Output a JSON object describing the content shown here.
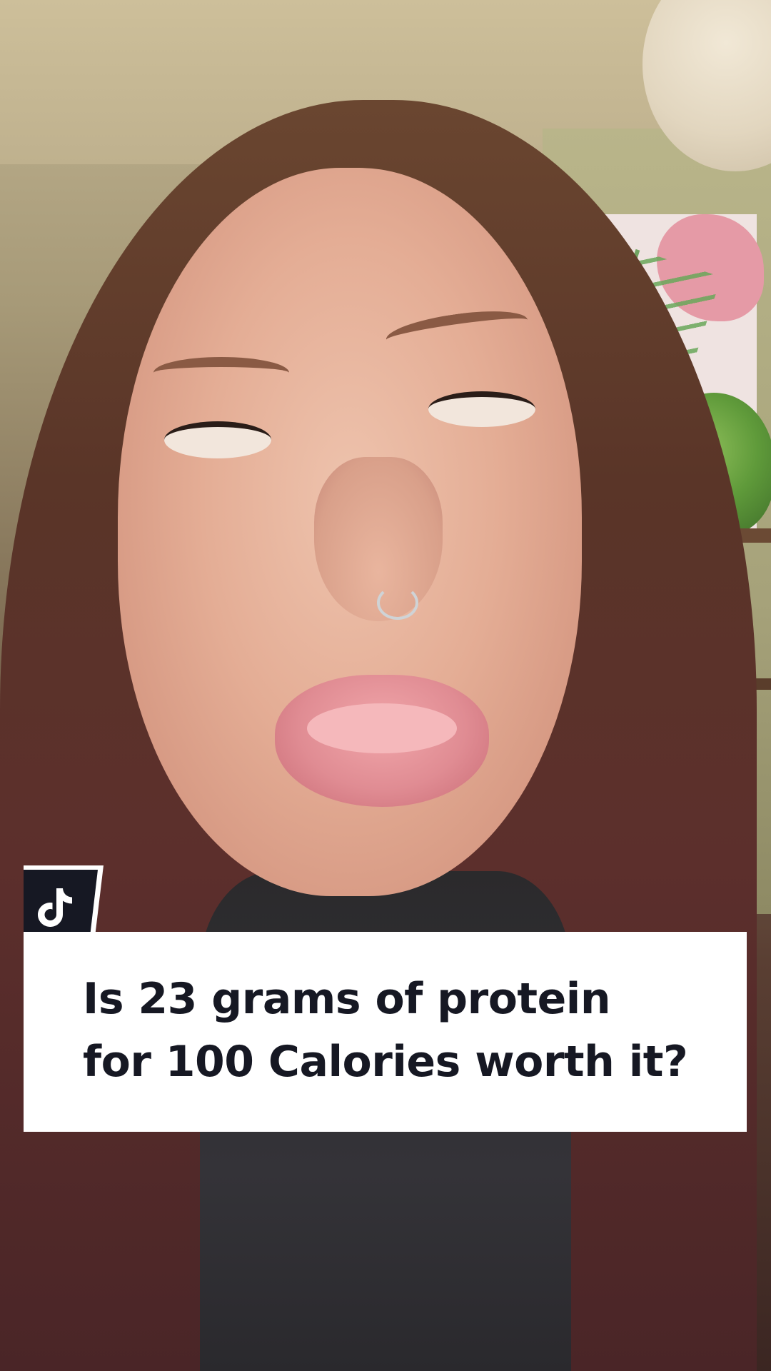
{
  "overlay": {
    "caption": "Is 23 grams of protein for 100 Calories worth it?",
    "badge_icon": "tiktok-logo-icon"
  },
  "colors": {
    "card_background": "#ffffff",
    "caption_text": "#161823",
    "badge_background": "#161823"
  }
}
